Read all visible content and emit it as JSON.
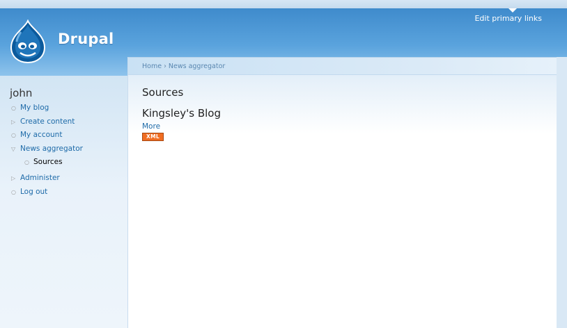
{
  "header": {
    "site_name": "Drupal",
    "edit_primary_links": "Edit primary links",
    "logo_icon": "drupal-drop-icon"
  },
  "sidebar": {
    "user_name": "john",
    "items": [
      {
        "label": "My blog",
        "marker": "○"
      },
      {
        "label": "Create content",
        "marker": "▷"
      },
      {
        "label": "My account",
        "marker": "○"
      },
      {
        "label": "News aggregator",
        "marker": "▽"
      },
      {
        "label": "Sources",
        "marker": "○"
      },
      {
        "label": "Administer",
        "marker": "▷"
      },
      {
        "label": "Log out",
        "marker": "○"
      }
    ]
  },
  "breadcrumb": {
    "items": [
      "Home",
      "News aggregator"
    ],
    "separator": "›"
  },
  "main": {
    "page_title": "Sources",
    "feed_title": "Kingsley's Blog",
    "more_label": "More",
    "xml_badge": "XML"
  },
  "colors": {
    "header_blue": "#3f8bcc",
    "link_blue": "#1d6aa8",
    "xml_orange": "#f06d22"
  }
}
